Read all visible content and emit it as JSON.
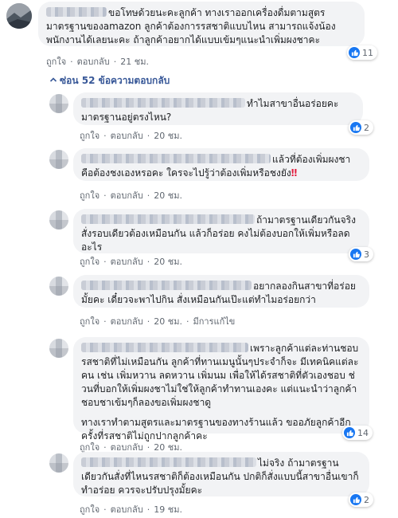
{
  "top_comment": {
    "text": "ขอโทษด้วยนะคะลูกค้า ทางเราออกเครื่องดื่มตามสูตรมาตรฐานของamazon ลูกค้าต้องการรสชาติแบบไหน สามารถแจ้งน้องพนักงานได้เลยนะคะ ถ้าลูกค้าอยากได้แบบเข้มๆแนะนำเพิ่มผงชาคะ",
    "like": "ถูกใจ",
    "reply": "ตอบกลับ",
    "time": "21 ชม.",
    "reaction_count": "11"
  },
  "replies_toggle": "ซ่อน 52 ข้อความตอบกลับ",
  "replies": [
    {
      "text": "ทำไมสาขาอื่นอร่อยคะ มาตรฐานอยู่ตรงไหน?",
      "like": "ถูกใจ",
      "reply": "ตอบกลับ",
      "time": "20 ชม.",
      "reaction_count": "2"
    },
    {
      "text": "แล้วที่ต้องเพิ่มผงชาคือต้องชงเองหรอคะ ใครจะไปรู้ว่าต้องเพิ่มหรือชงยัง",
      "emoji": "‼",
      "like": "ถูกใจ",
      "reply": "ตอบกลับ",
      "time": "20 ชม."
    },
    {
      "text": "ถ้ามาตรฐานเดียวกันจริงสั่งรอบเดียวต้องเหมือนกัน แล้วก็อร่อย คงไม่ต้องบอกให้เพิ่มหรือลดอะไร",
      "like": "ถูกใจ",
      "reply": "ตอบกลับ",
      "time": "20 ชม.",
      "reaction_count": "3"
    },
    {
      "text": "อยากลองกินสาขาที่อร่อยมั้ยคะ เดี๋ยวจะพาไปกิน สั่งเหมือนกันเป๊ะแต่ทำไมอร่อยกว่า",
      "like": "ถูกใจ",
      "reply": "ตอบกลับ",
      "time": "20 ชม.",
      "edited": "มีการแก้ไข"
    },
    {
      "text": "เพราะลูกค้าแต่ละท่านชอบรสชาติที่ไม่เหมือนกัน ลูกค้าที่ทานเมนูนั้นๆประจำก็จะ มีเทคนิคแต่ละคน เช่น เพิ่มหวาน ลดหวาน เพิ่มนม เพื่อให้ได้รสชาติที่ตัวเองชอบ ช่วนที่บอกให้เพิ่มผงชาไม่ใช่ให้ลูกค้าทำทานเองคะ แต่แนะนำว่าลูกค้าชอบชาเข้มๆก็ลองขอเพิ่มผงชาดู",
      "text2": "ทางเราทำตามสูตรและมาตรฐานของทางร้านแล้ว ขออภัยลูกค้าอีกครั้งที่รสชาติไม่ถูกปากลูกค้าคะ",
      "like": "ถูกใจ",
      "reply": "ตอบกลับ",
      "time": "20 ชม.",
      "reaction_count": "14"
    },
    {
      "text": "ไม่จริง ถ้ามาตรฐานเดียวกันสั่งที่ไหนรสชาติก็ต้องเหมือนกัน ปกติก็สั่งแบบนี้สาขาอื่นเขาก็ทำอร่อย ควรจะปรับปรุงมั้ยคะ",
      "like": "ถูกใจ",
      "reply": "ตอบกลับ",
      "time": "19 ชม.",
      "reaction_count": "2"
    }
  ],
  "colors": {
    "link": "#385898",
    "like_blue": "#1877f2",
    "bubble": "#f2f3f5",
    "meta": "#606770"
  }
}
